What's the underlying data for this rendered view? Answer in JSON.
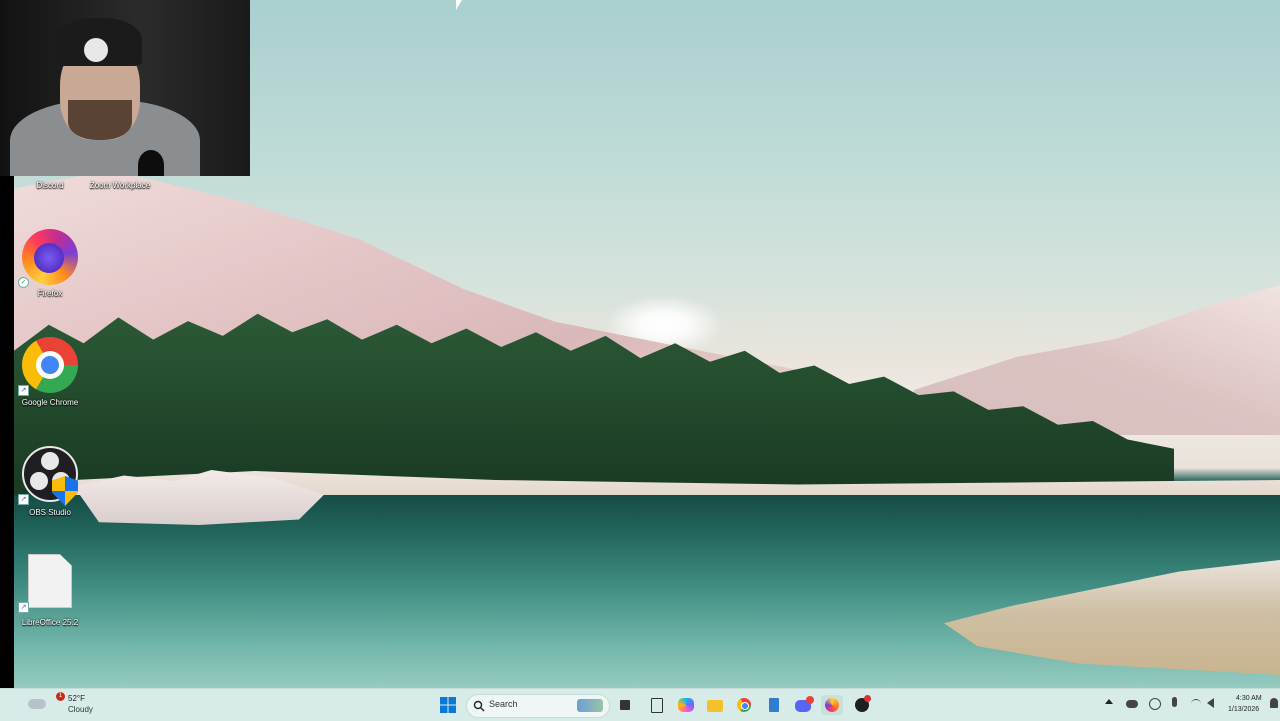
{
  "desktop": {
    "icons": [
      {
        "label": "Discord"
      },
      {
        "label": "Zoom Workplace"
      },
      {
        "label": "Firefox"
      },
      {
        "label": "Google Chrome"
      },
      {
        "label": "OBS Studio"
      },
      {
        "label": "LibreOffice 25.2"
      }
    ]
  },
  "taskbar": {
    "weather": {
      "temp": "52°F",
      "desc": "Cloudy",
      "badge": "1"
    },
    "search": {
      "placeholder": "Search"
    },
    "pinned": [
      "windows-start-icon",
      "search-icon",
      "task-view-icon",
      "notepad-icon",
      "copilot-icon",
      "file-explorer-icon",
      "chrome-icon",
      "notepad-app-icon",
      "discord-icon",
      "firefox-icon",
      "obs-icon"
    ],
    "tray": {
      "time": "4:30 AM",
      "date": "1/13/2026"
    }
  },
  "colors": {
    "taskbar_bg": "#d7ece9",
    "accent": "#0078d4"
  }
}
